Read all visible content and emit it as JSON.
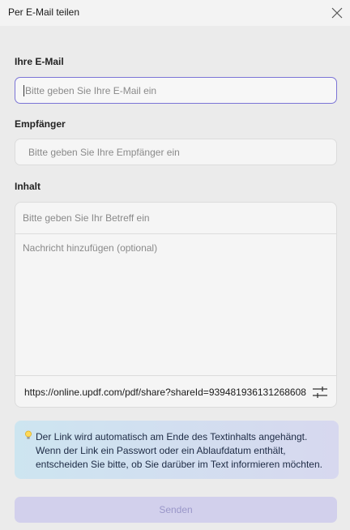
{
  "window": {
    "title": "Per E-Mail teilen"
  },
  "form": {
    "email_label": "Ihre E-Mail",
    "email_placeholder": "Bitte geben Sie Ihre E-Mail ein",
    "recipient_label": "Empfänger",
    "recipient_placeholder": "Bitte geben Sie Ihre Empfänger ein",
    "content_label": "Inhalt",
    "subject_placeholder": "Bitte geben Sie Ihr Betreff ein",
    "message_placeholder": "Nachricht hinzufügen (optional)",
    "share_link": "https://online.updf.com/pdf/share?shareId=939481936131268608"
  },
  "info": {
    "icon": "lightbulb-icon",
    "lines": [
      "Der Link wird automatisch am Ende des Textinhalts angehängt.",
      "Wenn der Link ein Passwort oder ein Ablaufdatum enthält,",
      "entscheiden Sie bitte, ob Sie darüber im Text informieren möchten."
    ]
  },
  "actions": {
    "send_label": "Senden"
  },
  "colors": {
    "accent": "#7b74d6",
    "send_button_bg": "#d2d0ec",
    "send_button_text": "#9a97c9",
    "info_gradient_start": "#cde5f0",
    "info_gradient_end": "#d7d8ef"
  }
}
